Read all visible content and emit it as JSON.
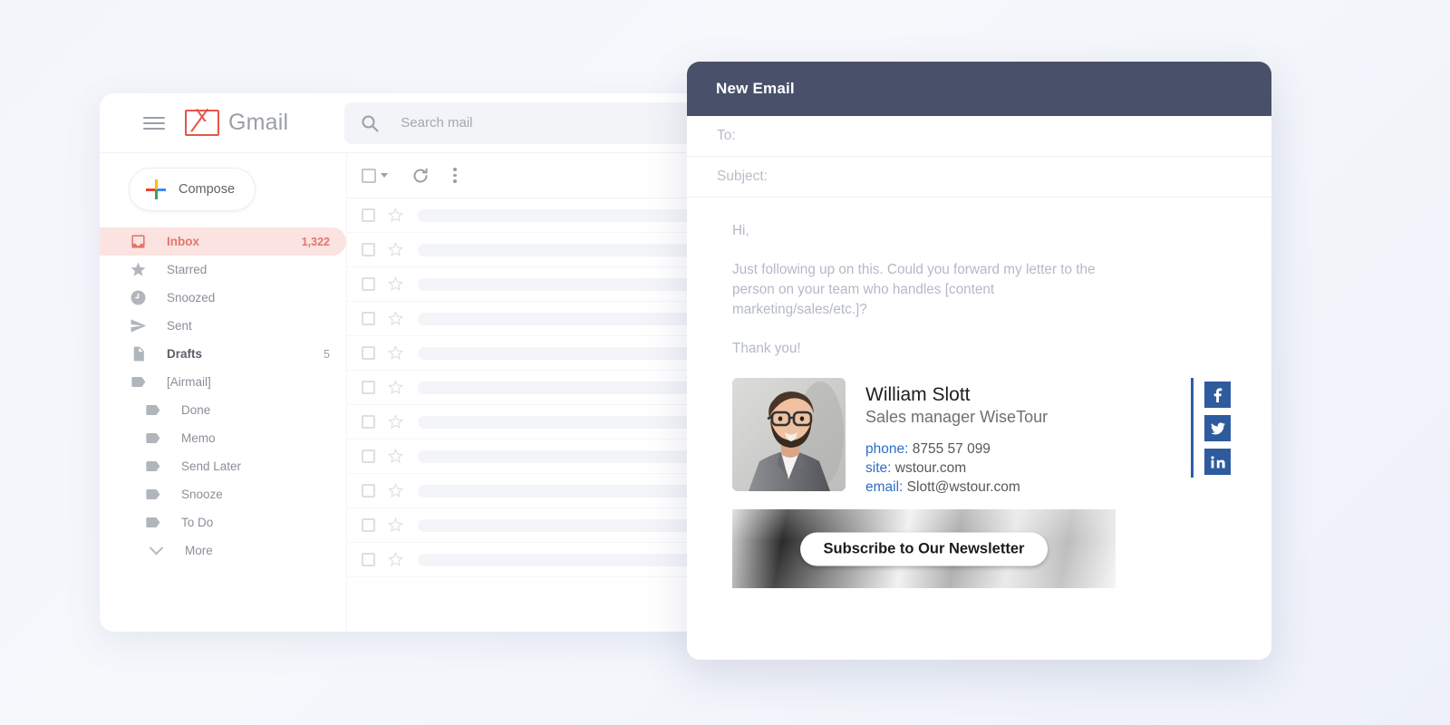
{
  "gmail": {
    "brand": "Gmail",
    "hamburger_icon": "menu-icon",
    "logo_icon": "gmail-m-icon",
    "search": {
      "placeholder": "Search mail",
      "value": "",
      "icon": "search-icon"
    },
    "compose": {
      "label": "Compose",
      "icon": "plus-icon"
    },
    "nav": [
      {
        "label": "Inbox",
        "count": "1,322",
        "icon": "inbox-icon",
        "state": "active",
        "level": 0
      },
      {
        "label": "Starred",
        "count": "",
        "icon": "star-icon",
        "state": "normal",
        "level": 0
      },
      {
        "label": "Snoozed",
        "count": "",
        "icon": "clock-icon",
        "state": "normal",
        "level": 0
      },
      {
        "label": "Sent",
        "count": "",
        "icon": "send-icon",
        "state": "normal",
        "level": 0
      },
      {
        "label": "Drafts",
        "count": "5",
        "icon": "draft-icon",
        "state": "bold",
        "level": 0
      },
      {
        "label": "[Airmail]",
        "count": "",
        "icon": "label-icon",
        "state": "expanded",
        "level": 0
      },
      {
        "label": "Done",
        "count": "",
        "icon": "label-icon",
        "state": "normal",
        "level": 1
      },
      {
        "label": "Memo",
        "count": "",
        "icon": "label-icon",
        "state": "normal",
        "level": 1
      },
      {
        "label": "Send Later",
        "count": "",
        "icon": "label-icon",
        "state": "normal",
        "level": 1
      },
      {
        "label": "Snooze",
        "count": "",
        "icon": "label-icon",
        "state": "normal",
        "level": 1
      },
      {
        "label": "To Do",
        "count": "",
        "icon": "label-icon",
        "state": "normal",
        "level": 1
      },
      {
        "label": "More",
        "count": "",
        "icon": "chevron-down-icon",
        "state": "more",
        "level": 0
      }
    ],
    "toolbar": {
      "select_all_icon": "checkbox-icon",
      "select_dropdown_icon": "caret-down-icon",
      "refresh_icon": "refresh-icon",
      "more_icon": "more-vertical-icon"
    },
    "list_rows": 11
  },
  "compose": {
    "title": "New Email",
    "to": {
      "label": "To:",
      "value": ""
    },
    "subject": {
      "label": "Subject:",
      "value": ""
    },
    "body": [
      "Hi,",
      "Just following up on this. Could you forward my letter to the person on your team who handles [content marketing/sales/etc.]?",
      "Thank you!"
    ],
    "signature": {
      "photo_alt": "portrait-photo",
      "name": "William Slott",
      "role": "Sales manager WiseTour",
      "contacts": [
        {
          "key": "phone:",
          "value": "8755 57 099"
        },
        {
          "key": "site:",
          "value": "wstour.com"
        },
        {
          "key": "email:",
          "value": "Slott@wstour.com"
        }
      ],
      "social": [
        {
          "name": "facebook-icon",
          "glyph": "f"
        },
        {
          "name": "twitter-icon",
          "glyph": "t"
        },
        {
          "name": "linkedin-icon",
          "glyph": "in"
        }
      ],
      "banner": {
        "cta": "Subscribe to Our Newsletter"
      }
    }
  },
  "colors": {
    "page_bg": "#f4f6fb",
    "compose_header": "#49516a",
    "inbox_pill": "#fbe3e1",
    "inbox_text": "#e2776c",
    "social_blue": "#2d5b9e",
    "link_blue": "#2e6fc4"
  }
}
